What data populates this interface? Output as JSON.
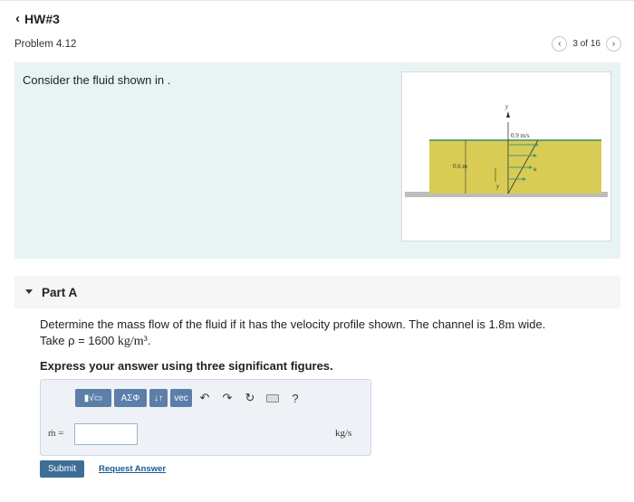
{
  "header": {
    "back_label": "HW#3"
  },
  "problem_bar": {
    "title": "Problem 4.12",
    "pager_text": "3 of 16"
  },
  "problem": {
    "text": "Consider the fluid shown in .",
    "figure": {
      "axis_y": "y",
      "velocity_label": "0.9 m/s",
      "depth_label": "0.6 m",
      "u_label": "u",
      "y_label": "y"
    }
  },
  "partA": {
    "label": "Part A",
    "question_line1_pre": "Determine the mass flow of the fluid if it has the velocity profile shown. The channel is 1.8",
    "question_line1_unit": "m",
    "question_line1_post": " wide.",
    "question_line2_pre": "Take ρ = 1600",
    "question_line2_unit": "kg/m³",
    "question_line2_post": ".",
    "instruction": "Express your answer using three significant figures."
  },
  "toolbar": {
    "templates": "▮√▭",
    "symbols": "ΑΣΦ",
    "arrows": "↓↑",
    "vec": "vec",
    "undo": "↶",
    "redo": "↷",
    "reset": "↻",
    "help": "?"
  },
  "answer": {
    "label": "ṁ =",
    "value": "",
    "units": "kg/s"
  },
  "actions": {
    "submit": "Submit",
    "request": "Request Answer"
  }
}
